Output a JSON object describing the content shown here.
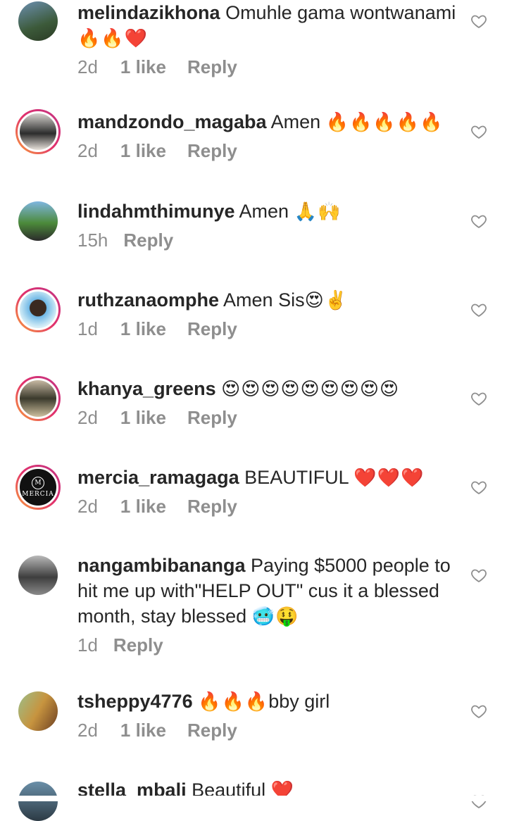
{
  "comments": [
    {
      "user": "melindazikhona",
      "text": "Omuhle gama wontwanami",
      "emoji": "🔥🔥❤️",
      "time": "2d",
      "likes": "1 like",
      "reply": "Reply"
    },
    {
      "user": "mandzondo_magaba",
      "text": "Amen",
      "emoji": "🔥🔥🔥🔥🔥",
      "time": "2d",
      "likes": "1 like",
      "reply": "Reply"
    },
    {
      "user": "lindahmthimunye",
      "text": "Amen",
      "emoji": "🙏🙌",
      "time": "15h",
      "likes": "",
      "reply": "Reply"
    },
    {
      "user": "ruthzanaomphe",
      "text": "Amen Sis",
      "emoji": "😍✌️",
      "time": "1d",
      "likes": "1 like",
      "reply": "Reply"
    },
    {
      "user": "khanya_greens",
      "text": "",
      "emoji": "😍😍😍😍😍😍😍😍😍",
      "time": "2d",
      "likes": "1 like",
      "reply": "Reply"
    },
    {
      "user": "mercia_ramagaga",
      "text": "BEAUTIFUL",
      "emoji": "❤️❤️❤️",
      "time": "2d",
      "likes": "1 like",
      "reply": "Reply",
      "avatar_text": "MERCIA"
    },
    {
      "user": "nangambibananga",
      "text": "Paying $5000 people to hit me up with\"HELP OUT\" cus it a blessed month, stay blessed",
      "emoji": "🥶🤑",
      "time": "1d",
      "likes": "",
      "reply": "Reply"
    },
    {
      "user": "tsheppy4776",
      "text": "",
      "emoji": "🔥🔥🔥",
      "suffix": "bby girl",
      "time": "2d",
      "likes": "1 like",
      "reply": "Reply"
    },
    {
      "user": "stella_mbali",
      "text": "Beautiful",
      "emoji": "❤️"
    }
  ],
  "colors": {
    "muted": "#8e8e8e",
    "text": "#262626",
    "ring_start": "#f9a13a",
    "ring_end": "#c13584"
  }
}
